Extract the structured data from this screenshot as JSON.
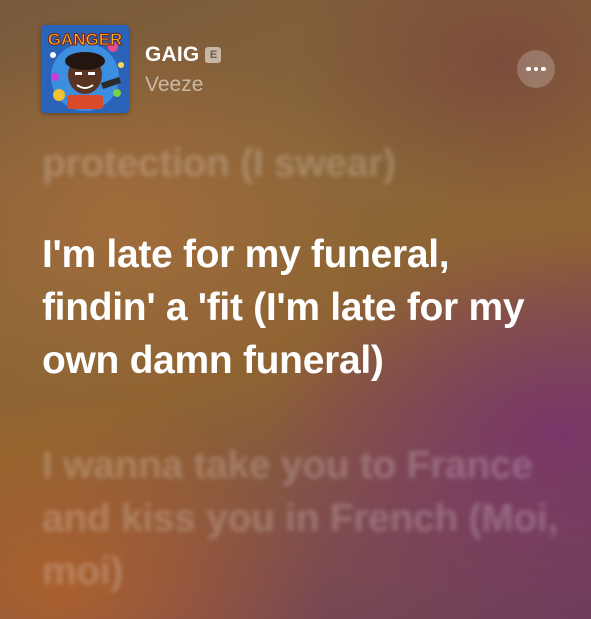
{
  "now_playing": {
    "title": "GAIG",
    "explicit_badge": "E",
    "artist": "Veeze",
    "album_art": {
      "logo_text": "GANGER",
      "icon": "album-cover"
    },
    "more_button": {
      "icon": "ellipsis-icon"
    }
  },
  "lyrics": {
    "previous": "protection (I swear)",
    "current": "I'm late for my funeral, findin' a 'fit (I'm late for my own damn funeral)",
    "next": "I wanna take you to France and kiss you in French (Moi, moi)"
  },
  "colors": {
    "background_primary": "#8a6638",
    "background_accent": "#6d3f5a",
    "lyric_active": "#ffffff"
  }
}
